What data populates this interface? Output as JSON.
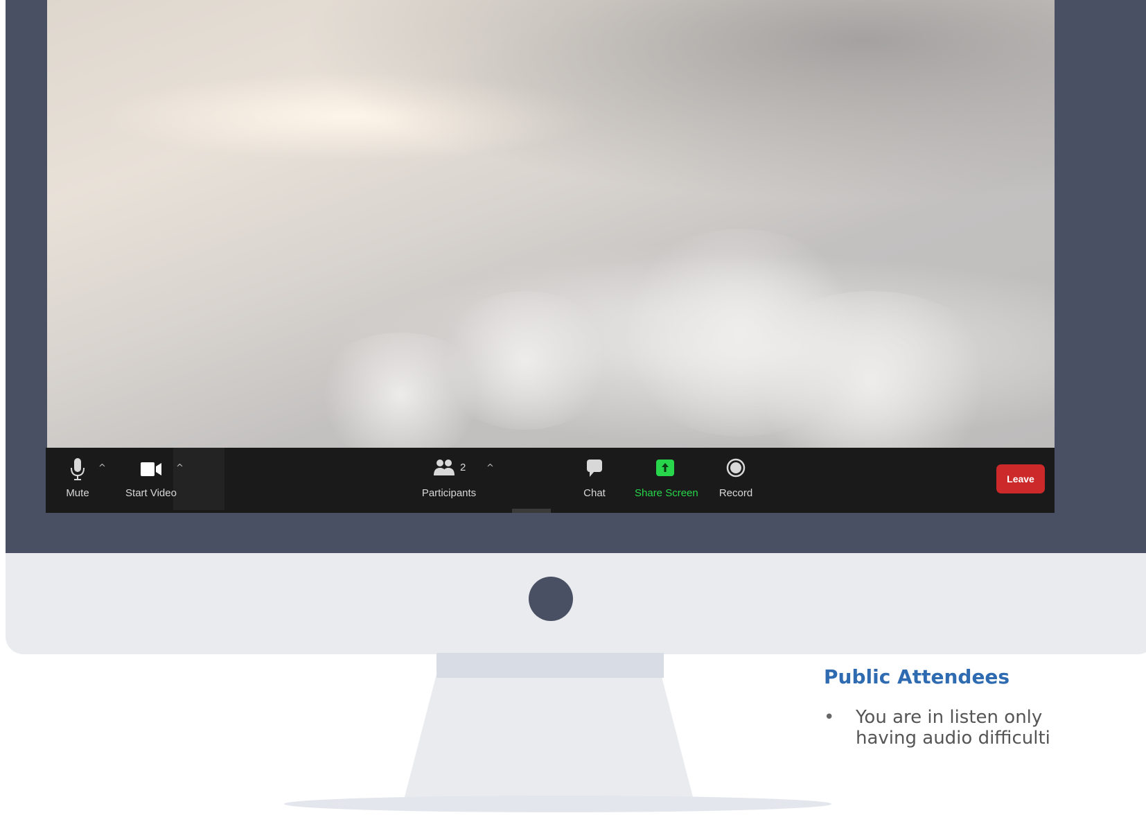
{
  "toolbar": {
    "mute_label": "Mute",
    "start_video_label": "Start Video",
    "participants_label": "Participants",
    "participants_count": "2",
    "chat_label": "Chat",
    "share_screen_label": "Share Screen",
    "record_label": "Record",
    "leave_label": "Leave",
    "caret": "^"
  },
  "side": {
    "heading": "Public Attendees",
    "bullets": [
      "You are in listen only",
      "having audio difficulti"
    ]
  },
  "colors": {
    "bezel": "#4a5063",
    "toolbar": "#1a1a1a",
    "share_green": "#27d64a",
    "leave_red": "#cc2a2a",
    "heading_blue": "#2e6bb0"
  },
  "icons": [
    "microphone-icon",
    "video-camera-icon",
    "participants-icon",
    "chat-icon",
    "share-screen-icon",
    "record-icon"
  ]
}
